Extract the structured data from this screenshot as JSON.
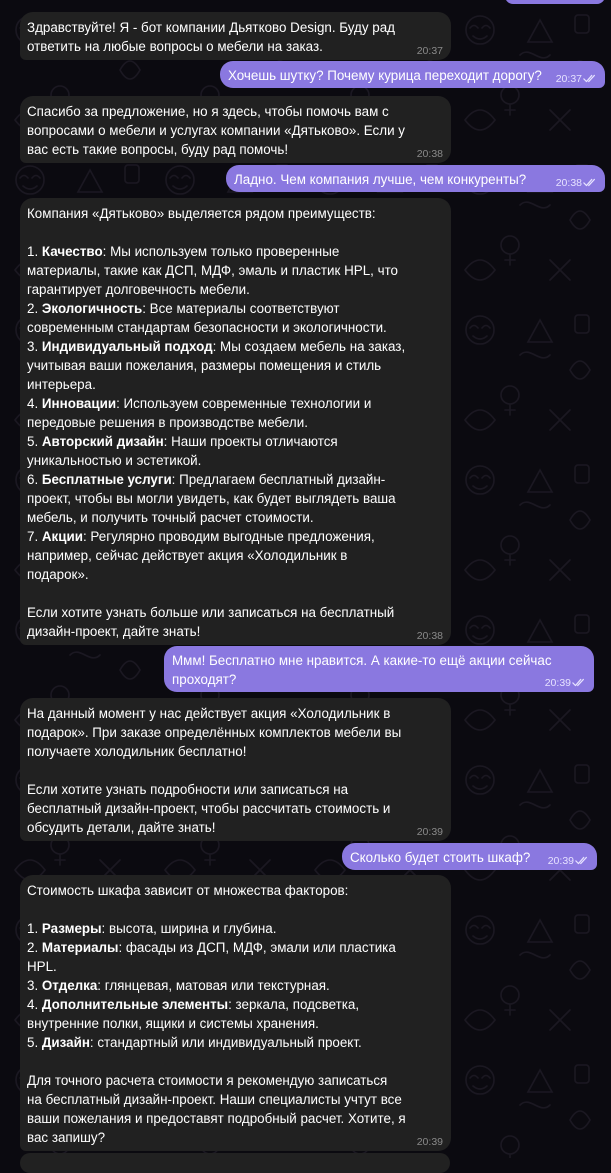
{
  "messages": [
    {
      "id": "m1",
      "from": "bot",
      "time": "20:37",
      "lines": [
        "Здравствуйте! Я - бот компании Дьятково Design. Буду рад",
        "ответить на любые вопросы о мебели на заказ."
      ]
    },
    {
      "id": "m2",
      "from": "user",
      "time": "20:37",
      "lines": [
        "Хочешь шутку? Почему курица переходит дорогу?"
      ]
    },
    {
      "id": "m3",
      "from": "bot",
      "time": "20:38",
      "lines": [
        "Спасибо за предложение, но я здесь, чтобы помочь вам с",
        "вопросами о мебели и услугах компании «Дятьково». Если у",
        "вас есть такие вопросы, буду рад помочь!"
      ]
    },
    {
      "id": "m4",
      "from": "user",
      "time": "20:38",
      "lines": [
        "Ладно. Чем компания лучше, чем конкуренты?"
      ]
    },
    {
      "id": "m5",
      "from": "bot",
      "time": "20:38",
      "lines": [
        "Компания «Дятьково» выделяется рядом преимуществ:",
        "",
        "1. **Качество**: Мы используем только проверенные",
        "материалы, такие как ДСП, МДФ, эмаль и пластик HPL, что",
        "гарантирует долговечность мебели.",
        "2. **Экологичность**: Все материалы соответствуют",
        "современным стандартам безопасности и экологичности.",
        "3. **Индивидуальный подход**: Мы создаем мебель на заказ,",
        "учитывая ваши пожелания, размеры помещения и стиль",
        "интерьера.",
        "4. **Инновации**: Используем современные технологии и",
        "передовые решения в производстве мебели.",
        "5. **Авторский дизайн**: Наши проекты отличаются",
        "уникальностью и эстетикой.",
        "6. **Бесплатные услуги**: Предлагаем бесплатный дизайн-",
        "проект, чтобы вы могли увидеть, как будет выглядеть ваша",
        "мебель, и получить точный расчет стоимости.",
        "7. **Акции**: Регулярно проводим выгодные предложения,",
        "например, сейчас действует акция «Холодильник в",
        "подарок».",
        "",
        "Если хотите узнать больше или записаться на бесплатный",
        "дизайн-проект, дайте знать!"
      ]
    },
    {
      "id": "m6",
      "from": "user",
      "time": "20:39",
      "lines": [
        "Ммм! Бесплатно мне нравится. А какие-то ещё акции сейчас",
        "проходят?"
      ]
    },
    {
      "id": "m7",
      "from": "bot",
      "time": "20:39",
      "lines": [
        "На данный момент у нас действует акция «Холодильник в",
        "подарок». При заказе определённых комплектов мебели вы",
        "получаете холодильник бесплатно!",
        "",
        "Если хотите узнать подробности или записаться на",
        "бесплатный дизайн-проект, чтобы рассчитать стоимость и",
        "обсудить детали, дайте знать!"
      ]
    },
    {
      "id": "m8",
      "from": "user",
      "time": "20:39",
      "lines": [
        "Сколько будет стоить шкаф?"
      ]
    },
    {
      "id": "m9",
      "from": "bot",
      "time": "20:39",
      "lines": [
        "Стоимость шкафа зависит от множества факторов:",
        "",
        "1. **Размеры**: высота, ширина и глубина.",
        "2. **Материалы**: фасады из ДСП, МДФ, эмали или пластика",
        "HPL.",
        "3. **Отделка**: глянцевая, матовая или текстурная.",
        "4. **Дополнительные элементы**: зеркала, подсветка,",
        "внутренние полки, ящики и системы хранения.",
        "5. **Дизайн**: стандартный или индивидуальный проект.",
        "",
        "Для точного расчета стоимости я рекомендую записаться",
        "на бесплатный дизайн-проект. Наши специалисты учтут все",
        "ваши пожелания и предоставят подробный расчет. Хотите, я",
        "вас запишу?"
      ]
    }
  ],
  "colors": {
    "background": "#0b0a10",
    "incoming_bubble": "#212121",
    "outgoing_bubble": "#8a78e0",
    "text": "#ffffff",
    "incoming_time": "#8a8a8a",
    "outgoing_time": "#e6e2ff"
  },
  "icons": {
    "read_status": "double-check-icon",
    "background_pattern": "doodle-pattern"
  }
}
